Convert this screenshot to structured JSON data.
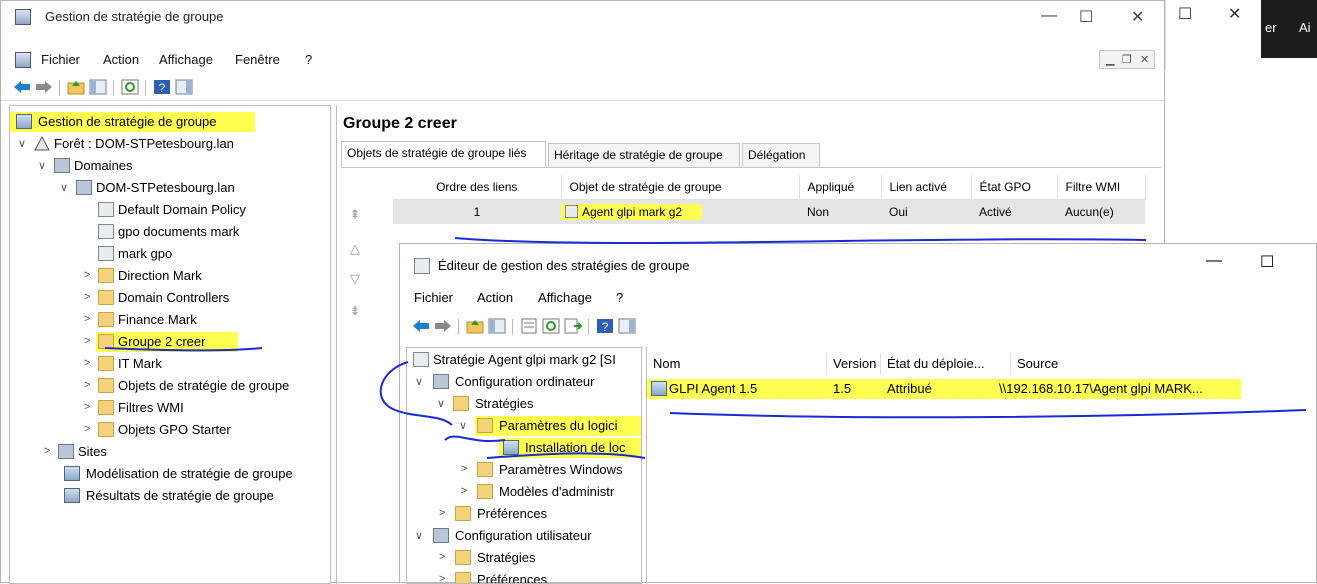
{
  "main": {
    "title": "Gestion de stratégie de groupe",
    "menu": [
      "Fichier",
      "Action",
      "Affichage",
      "Fenêtre",
      "?"
    ]
  },
  "tree": {
    "root": "Gestion de stratégie de groupe",
    "forest": "Forêt : DOM-STPetesbourg.lan",
    "domains": "Domaines",
    "domain": "DOM-STPetesbourg.lan",
    "items": [
      "Default Domain Policy",
      "gpo documents mark",
      "mark gpo",
      "Direction Mark",
      "Domain Controllers",
      "Finance Mark",
      "Groupe 2 creer",
      "IT Mark",
      "Objets de stratégie de groupe",
      "Filtres WMI",
      "Objets GPO Starter"
    ],
    "sites": "Sites",
    "modeling": "Modélisation de stratégie de groupe",
    "results": "Résultats de stratégie de groupe"
  },
  "content": {
    "title": "Groupe 2 creer",
    "tabs": [
      "Objets de stratégie de groupe liés",
      "Héritage de stratégie de groupe",
      "Délégation"
    ],
    "columns": [
      "Ordre des liens",
      "Objet de stratégie de groupe",
      "Appliqué",
      "Lien activé",
      "État GPO",
      "Filtre WMI"
    ],
    "rows": [
      {
        "order": "1",
        "gpo": "Agent glpi mark g2",
        "applied": "Non",
        "enabled": "Oui",
        "status": "Activé",
        "wmi": "Aucun(e)"
      }
    ]
  },
  "editor": {
    "title": "Éditeur de gestion des stratégies de groupe",
    "menu": [
      "Fichier",
      "Action",
      "Affichage",
      "?"
    ],
    "tree": {
      "root": "Stratégie Agent glpi mark g2 [SI",
      "computer": "Configuration ordinateur",
      "policies": "Stratégies",
      "software": "Paramètres du logici",
      "install": "Installation de loc",
      "windows": "Paramètres Windows",
      "admin": "Modèles d'administr",
      "prefs": "Préférences",
      "user": "Configuration utilisateur",
      "user_policies": "Stratégies",
      "user_prefs": "Préférences"
    },
    "list": {
      "columns": [
        "Nom",
        "Version",
        "État du déploie...",
        "Source"
      ],
      "rows": [
        {
          "name": "GLPI Agent 1.5",
          "version": "1.5",
          "state": "Attribué",
          "source": "\\\\192.168.10.17\\Agent glpi MARK..."
        }
      ]
    }
  },
  "background": {
    "text1": "er",
    "text2": "Ai"
  },
  "colors": {
    "highlight": "#ffff52",
    "ink": "#1a2bd6"
  }
}
